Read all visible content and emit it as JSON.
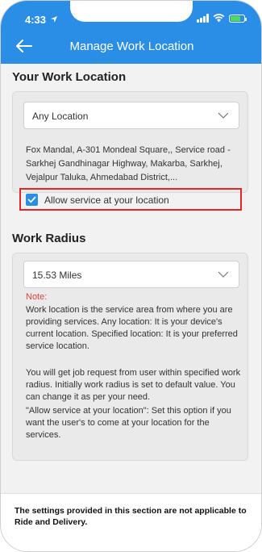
{
  "status_bar": {
    "time": "4:33"
  },
  "header": {
    "title": "Manage Work Location"
  },
  "work_location": {
    "section_title": "Your Work Location",
    "dropdown_value": "Any Location",
    "address": "Fox Mandal, A-301 Mondeal Square,, Service road - Sarkhej Gandhinagar Highway, Makarba, Sarkhej, Vejalpur Taluka, Ahmedabad District,...",
    "checkbox_label": "Allow service at your location",
    "checkbox_checked": true
  },
  "work_radius": {
    "section_title": "Work Radius",
    "dropdown_value": "15.53 Miles",
    "note_label": "Note:",
    "note_paragraphs": [
      "Work location is the service area from where you are providing services. Any location: It is your device's current location. Specified location: It is your preferred service location.",
      "You will get job request from user within specified work radius. Initially work radius is set to default value. You can change it as per your need.",
      "\"Allow service at your location\": Set this option if you want the user's to come at your location for the services."
    ]
  },
  "footer": {
    "text": "The settings provided in this section are not applicable to Ride and Delivery."
  },
  "colors": {
    "accent": "#2b8ee6",
    "highlight_border": "#e32626",
    "note_label": "#e04040"
  }
}
